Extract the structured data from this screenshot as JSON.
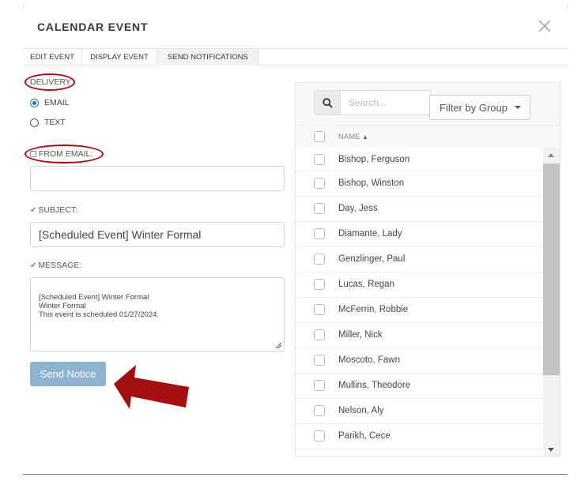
{
  "dialog": {
    "title": "CALENDAR EVENT"
  },
  "tabs": [
    {
      "label": "EDIT EVENT"
    },
    {
      "label": "DISPLAY EVENT"
    },
    {
      "label": "SEND NOTIFICATIONS",
      "active": true
    }
  ],
  "form": {
    "delivery_label": "DELIVERY",
    "delivery_options": [
      {
        "label": "EMAIL",
        "selected": true
      },
      {
        "label": "TEXT",
        "selected": false
      }
    ],
    "from_email_label": "FROM EMAIL:",
    "from_email_value": "",
    "subject_label": "SUBJECT:",
    "subject_value": "[Scheduled Event] Winter Formal",
    "message_label": "MESSAGE:",
    "message_value": "[Scheduled Event] Winter Formal\nWinter Formal\nThis event is scheduled 01/27/2024.",
    "send_button": "Send Notice"
  },
  "recipients": {
    "search_placeholder": "Search...",
    "filter_label": "Filter by Group",
    "column_header": "NAME",
    "sort_indicator": "▲",
    "names": [
      "Bishop, Ferguson",
      "Bishop, Winston",
      "Day, Jess",
      "Diamante, Lady",
      "Genzlinger, Paul",
      "Lucas, Regan",
      "McFerrin, Robbie",
      "Miller, Nick",
      "Moscoto, Fawn",
      "Mullins, Theodore",
      "Nelson, Aly",
      "Parikh, Cece"
    ]
  },
  "annotation_colors": {
    "highlight": "#a50f0f",
    "accent": "#1a73c8",
    "check": "#57a845",
    "button": "#8eb3d1"
  }
}
